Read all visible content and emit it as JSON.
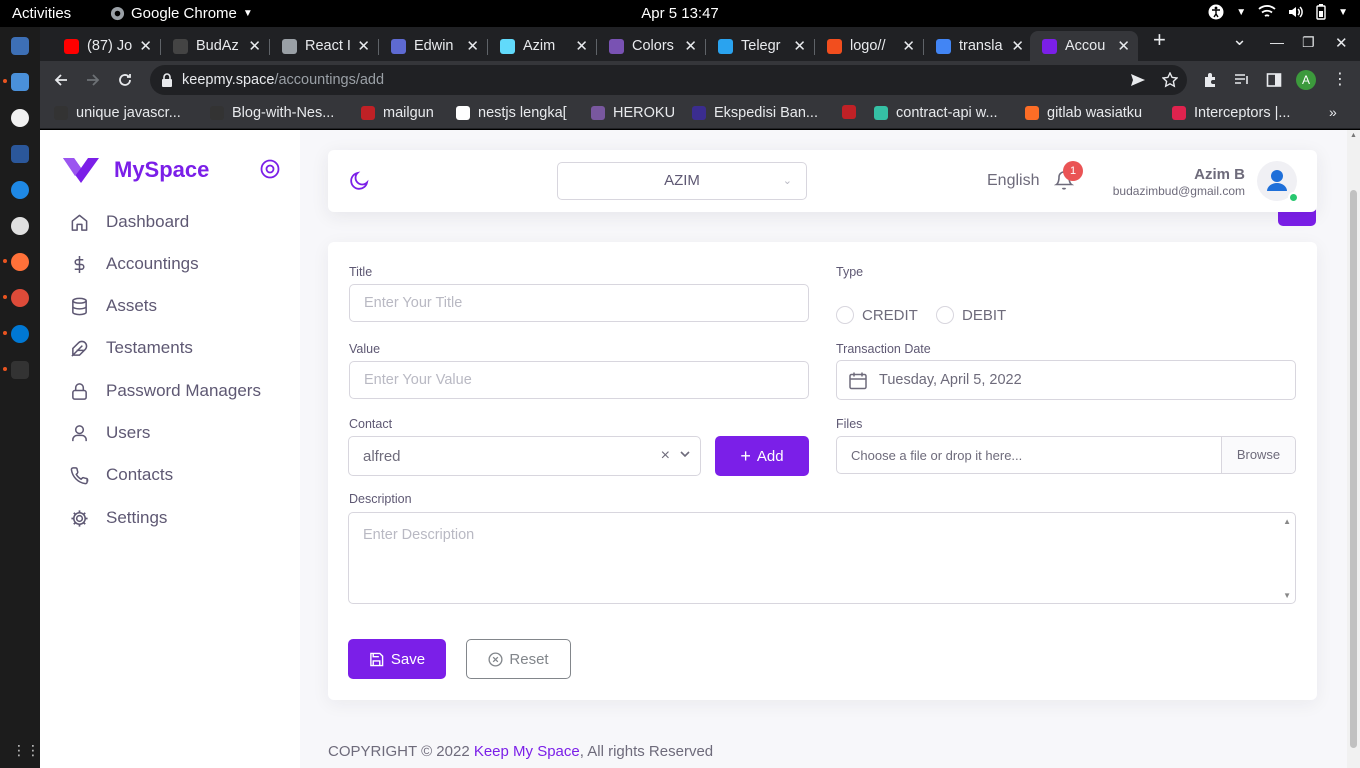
{
  "system": {
    "activities": "Activities",
    "app_name": "Google Chrome",
    "clock": "Apr 5  13:47"
  },
  "browser": {
    "tabs": [
      {
        "label": "(87) Jo",
        "icon": "youtube-icon",
        "color": "#ff0000"
      },
      {
        "label": "BudAz",
        "icon": "github-icon",
        "color": "#444444"
      },
      {
        "label": "React I",
        "icon": "globe-icon",
        "color": "#9aa0a6"
      },
      {
        "label": "Edwin",
        "icon": "linear-icon",
        "color": "#5e6ad2"
      },
      {
        "label": "Azim",
        "icon": "react-icon",
        "color": "#61dafb"
      },
      {
        "label": "Colors",
        "icon": "bootstrap-icon",
        "color": "#7952b3"
      },
      {
        "label": "Telegr",
        "icon": "telegram-icon",
        "color": "#2aa3ef"
      },
      {
        "label": "logo//",
        "icon": "figma-icon",
        "color": "#f24e1e"
      },
      {
        "label": "transla",
        "icon": "google-icon",
        "color": "#4285f4"
      },
      {
        "label": "Accou",
        "icon": "myspace-icon",
        "color": "#7b1fe8"
      }
    ],
    "url_host": "keepmy.space",
    "url_path": "/accountings/add",
    "profile_initial": "A",
    "bookmarks": [
      {
        "label": "unique javascr...",
        "icon": "github-icon",
        "color": "#333333"
      },
      {
        "label": "Blog-with-Nes...",
        "icon": "github-icon",
        "color": "#333333"
      },
      {
        "label": "mailgun",
        "icon": "mailgun-icon",
        "color": "#c02126"
      },
      {
        "label": "nestjs lengka[",
        "icon": "wattpad-icon",
        "color": "#ffffff"
      },
      {
        "label": "HEROKU",
        "icon": "heroku-icon",
        "color": "#79589f"
      },
      {
        "label": "Ekspedisi Ban...",
        "icon": "flag-icon",
        "color": "#3b2d8f"
      },
      {
        "label": "",
        "icon": "mailgun-icon",
        "color": "#c02126"
      },
      {
        "label": "contract-api w...",
        "icon": "heart-icon",
        "color": "#35c0a4"
      },
      {
        "label": "gitlab wasiatku",
        "icon": "gitlab-icon",
        "color": "#fc6d26"
      },
      {
        "label": "Interceptors |...",
        "icon": "nestjs-icon",
        "color": "#e0234e"
      }
    ]
  },
  "app": {
    "brand": "MySpace",
    "nav": [
      {
        "label": "Dashboard",
        "icon": "home-icon"
      },
      {
        "label": "Accountings",
        "icon": "dollar-icon"
      },
      {
        "label": "Assets",
        "icon": "database-icon"
      },
      {
        "label": "Testaments",
        "icon": "feather-icon"
      },
      {
        "label": "Password Managers",
        "icon": "lock-icon"
      },
      {
        "label": "Users",
        "icon": "user-icon"
      },
      {
        "label": "Contacts",
        "icon": "phone-icon"
      },
      {
        "label": "Settings",
        "icon": "gear-icon"
      }
    ],
    "header": {
      "org": "AZIM",
      "language": "English",
      "notification_count": "1",
      "user_name": "Azim B",
      "user_email": "budazimbud@gmail.com"
    },
    "form": {
      "title_label": "Title",
      "title_placeholder": "Enter Your Title",
      "type_label": "Type",
      "type_options": [
        "CREDIT",
        "DEBIT"
      ],
      "value_label": "Value",
      "value_placeholder": "Enter Your Value",
      "date_label": "Transaction Date",
      "date_value": "Tuesday, April 5, 2022",
      "contact_label": "Contact",
      "contact_value": "alfred",
      "add_label": "Add",
      "files_label": "Files",
      "files_placeholder": "Choose a file or drop it here...",
      "browse_label": "Browse",
      "description_label": "Description",
      "description_placeholder": "Enter Description",
      "save_label": "Save",
      "reset_label": "Reset"
    },
    "footer": {
      "prefix": "COPYRIGHT © 2022 ",
      "link": "Keep My Space",
      "suffix": ", All rights Reserved"
    }
  },
  "colors": {
    "primary": "#7b1fe8",
    "danger": "#ea5455",
    "success": "#28c76f"
  }
}
